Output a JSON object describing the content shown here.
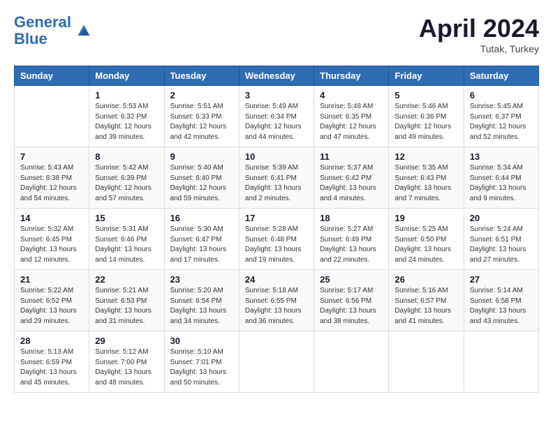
{
  "header": {
    "logo_line1": "General",
    "logo_line2": "Blue",
    "month": "April 2024",
    "location": "Tutak, Turkey"
  },
  "weekdays": [
    "Sunday",
    "Monday",
    "Tuesday",
    "Wednesday",
    "Thursday",
    "Friday",
    "Saturday"
  ],
  "weeks": [
    [
      {
        "day": "",
        "info": ""
      },
      {
        "day": "1",
        "info": "Sunrise: 5:53 AM\nSunset: 6:32 PM\nDaylight: 12 hours\nand 39 minutes."
      },
      {
        "day": "2",
        "info": "Sunrise: 5:51 AM\nSunset: 6:33 PM\nDaylight: 12 hours\nand 42 minutes."
      },
      {
        "day": "3",
        "info": "Sunrise: 5:49 AM\nSunset: 6:34 PM\nDaylight: 12 hours\nand 44 minutes."
      },
      {
        "day": "4",
        "info": "Sunrise: 5:48 AM\nSunset: 6:35 PM\nDaylight: 12 hours\nand 47 minutes."
      },
      {
        "day": "5",
        "info": "Sunrise: 5:46 AM\nSunset: 6:36 PM\nDaylight: 12 hours\nand 49 minutes."
      },
      {
        "day": "6",
        "info": "Sunrise: 5:45 AM\nSunset: 6:37 PM\nDaylight: 12 hours\nand 52 minutes."
      }
    ],
    [
      {
        "day": "7",
        "info": "Sunrise: 5:43 AM\nSunset: 6:38 PM\nDaylight: 12 hours\nand 54 minutes."
      },
      {
        "day": "8",
        "info": "Sunrise: 5:42 AM\nSunset: 6:39 PM\nDaylight: 12 hours\nand 57 minutes."
      },
      {
        "day": "9",
        "info": "Sunrise: 5:40 AM\nSunset: 6:40 PM\nDaylight: 12 hours\nand 59 minutes."
      },
      {
        "day": "10",
        "info": "Sunrise: 5:39 AM\nSunset: 6:41 PM\nDaylight: 13 hours\nand 2 minutes."
      },
      {
        "day": "11",
        "info": "Sunrise: 5:37 AM\nSunset: 6:42 PM\nDaylight: 13 hours\nand 4 minutes."
      },
      {
        "day": "12",
        "info": "Sunrise: 5:35 AM\nSunset: 6:43 PM\nDaylight: 13 hours\nand 7 minutes."
      },
      {
        "day": "13",
        "info": "Sunrise: 5:34 AM\nSunset: 6:44 PM\nDaylight: 13 hours\nand 9 minutes."
      }
    ],
    [
      {
        "day": "14",
        "info": "Sunrise: 5:32 AM\nSunset: 6:45 PM\nDaylight: 13 hours\nand 12 minutes."
      },
      {
        "day": "15",
        "info": "Sunrise: 5:31 AM\nSunset: 6:46 PM\nDaylight: 13 hours\nand 14 minutes."
      },
      {
        "day": "16",
        "info": "Sunrise: 5:30 AM\nSunset: 6:47 PM\nDaylight: 13 hours\nand 17 minutes."
      },
      {
        "day": "17",
        "info": "Sunrise: 5:28 AM\nSunset: 6:48 PM\nDaylight: 13 hours\nand 19 minutes."
      },
      {
        "day": "18",
        "info": "Sunrise: 5:27 AM\nSunset: 6:49 PM\nDaylight: 13 hours\nand 22 minutes."
      },
      {
        "day": "19",
        "info": "Sunrise: 5:25 AM\nSunset: 6:50 PM\nDaylight: 13 hours\nand 24 minutes."
      },
      {
        "day": "20",
        "info": "Sunrise: 5:24 AM\nSunset: 6:51 PM\nDaylight: 13 hours\nand 27 minutes."
      }
    ],
    [
      {
        "day": "21",
        "info": "Sunrise: 5:22 AM\nSunset: 6:52 PM\nDaylight: 13 hours\nand 29 minutes."
      },
      {
        "day": "22",
        "info": "Sunrise: 5:21 AM\nSunset: 6:53 PM\nDaylight: 13 hours\nand 31 minutes."
      },
      {
        "day": "23",
        "info": "Sunrise: 5:20 AM\nSunset: 6:54 PM\nDaylight: 13 hours\nand 34 minutes."
      },
      {
        "day": "24",
        "info": "Sunrise: 5:18 AM\nSunset: 6:55 PM\nDaylight: 13 hours\nand 36 minutes."
      },
      {
        "day": "25",
        "info": "Sunrise: 5:17 AM\nSunset: 6:56 PM\nDaylight: 13 hours\nand 38 minutes."
      },
      {
        "day": "26",
        "info": "Sunrise: 5:16 AM\nSunset: 6:57 PM\nDaylight: 13 hours\nand 41 minutes."
      },
      {
        "day": "27",
        "info": "Sunrise: 5:14 AM\nSunset: 6:58 PM\nDaylight: 13 hours\nand 43 minutes."
      }
    ],
    [
      {
        "day": "28",
        "info": "Sunrise: 5:13 AM\nSunset: 6:59 PM\nDaylight: 13 hours\nand 45 minutes."
      },
      {
        "day": "29",
        "info": "Sunrise: 5:12 AM\nSunset: 7:00 PM\nDaylight: 13 hours\nand 48 minutes."
      },
      {
        "day": "30",
        "info": "Sunrise: 5:10 AM\nSunset: 7:01 PM\nDaylight: 13 hours\nand 50 minutes."
      },
      {
        "day": "",
        "info": ""
      },
      {
        "day": "",
        "info": ""
      },
      {
        "day": "",
        "info": ""
      },
      {
        "day": "",
        "info": ""
      }
    ]
  ]
}
